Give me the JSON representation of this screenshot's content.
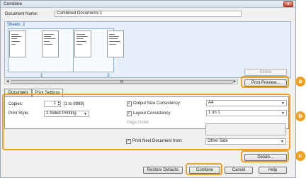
{
  "window": {
    "title": "Combine",
    "close_glyph": "x"
  },
  "document_name": {
    "label": "Document Name:",
    "value": "Combined Documents 1"
  },
  "preview": {
    "sheets_label": "Sheets: 2",
    "page_numbers": [
      "1",
      "2"
    ],
    "scroll_thumb_glyph": "III"
  },
  "side_buttons": {
    "delete": "Delete",
    "print_preview": "Print Preview..."
  },
  "tabs": [
    {
      "label": "Document List",
      "active": false
    },
    {
      "label": "Print Settings",
      "active": true
    }
  ],
  "print_settings": {
    "copies_label": "Copies:",
    "copies_value": "1",
    "copies_range": "[1 to 9999]",
    "print_style_label": "Print Style:",
    "print_style_value": "2-Sided Printing",
    "output_size_label": "Output Size Consistency:",
    "output_size_value": "A4",
    "output_size_checked": true,
    "layout_label": "Layout Consistency:",
    "layout_value": "1 on 1",
    "layout_checked": true,
    "page_order_label": "Page Order:",
    "page_order_value": "",
    "print_next_label": "Print Next Document from:",
    "print_next_value": "Other Side",
    "print_next_checked": true
  },
  "details_button": "Details...",
  "bottom_buttons": {
    "restore_defaults": "Restore Defaults",
    "combine": "Combine",
    "cancel": "Cancel",
    "help": "Help"
  },
  "callouts": [
    "a",
    "b",
    "c"
  ],
  "colors": {
    "callout": "#f0a020",
    "preview_bg": "#e6f0fb",
    "sheets_text": "#1a4f96"
  }
}
